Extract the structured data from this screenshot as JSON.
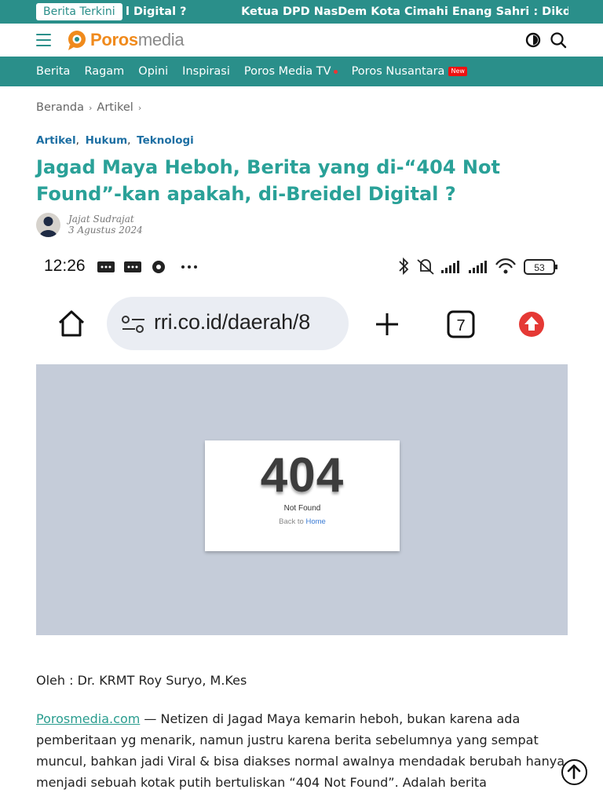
{
  "ticker": {
    "badge": "Berita Terkini",
    "items": [
      "l Digital ?",
      "Ketua DPD NasDem Kota Cimahi Enang Sahri : Dikdik Sel"
    ]
  },
  "brand": {
    "logo_part1": "Poros",
    "logo_part2": "media",
    "accent": "#2a8f8a",
    "logo_orange": "#f08a1c"
  },
  "header_icons": [
    "menu-icon",
    "dark-mode-icon",
    "search-icon"
  ],
  "nav": {
    "items": [
      {
        "label": "Berita"
      },
      {
        "label": "Ragam"
      },
      {
        "label": "Opini"
      },
      {
        "label": "Inspirasi"
      },
      {
        "label": "Poros Media TV"
      },
      {
        "label": "Poros Nusantara",
        "badge": "New"
      }
    ]
  },
  "breadcrumb": [
    "Beranda",
    "Artikel"
  ],
  "article": {
    "categories": [
      "Artikel",
      "Hukum",
      "Teknologi"
    ],
    "title": "Jagad Maya Heboh, Berita yang di-“404 Not Found”-kan apakah, di-Breidel Digital ?",
    "author": "Jajat Sudrajat",
    "date": "3 Agustus 2024",
    "image": {
      "time": "12:26",
      "battery": "53",
      "url": "rri.co.id/daerah/8",
      "tabs": "7",
      "error_code": "404",
      "error_text": "Not Found",
      "back_prefix": "Back to",
      "back_link": "Home"
    },
    "byline": "Oleh : Dr. KRMT Roy Suryo, M.Kes",
    "para_link": "Porosmedia.com",
    "para_text": " — Netizen di Jagad Maya kemarin heboh, bukan karena ada pemberitaan yg menarik, namun justru karena berita sebelumnya yang sempat muncul, bahkan jadi Viral & bisa diakses normal awalnya mendadak berubah hanya menjadi sebuah kotak putih bertuliskan “404 Not Found”. Adalah berita"
  }
}
